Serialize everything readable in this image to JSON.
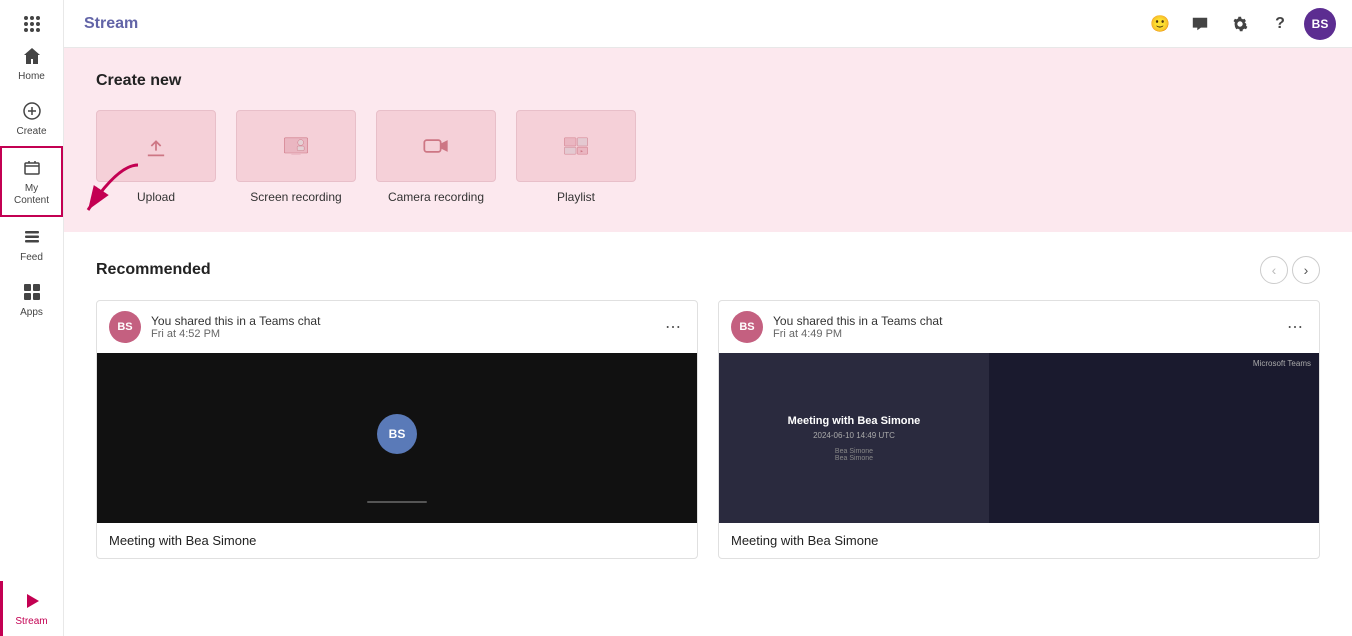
{
  "app": {
    "name": "Stream"
  },
  "topbar": {
    "icons": [
      "emoji",
      "chat",
      "settings",
      "help"
    ],
    "avatar_initials": "BS"
  },
  "sidebar": {
    "items": [
      {
        "id": "home",
        "label": "Home",
        "icon": "home"
      },
      {
        "id": "create",
        "label": "Create",
        "icon": "create"
      },
      {
        "id": "my-content",
        "label": "My Content",
        "icon": "my-content",
        "highlighted": true
      },
      {
        "id": "feed",
        "label": "Feed",
        "icon": "feed"
      },
      {
        "id": "apps",
        "label": "Apps",
        "icon": "apps"
      },
      {
        "id": "stream",
        "label": "Stream",
        "icon": "stream",
        "active": true
      }
    ]
  },
  "create_section": {
    "title": "Create new",
    "cards": [
      {
        "id": "upload",
        "label": "Upload",
        "icon": "upload"
      },
      {
        "id": "screen-recording",
        "label": "Screen recording",
        "icon": "screen"
      },
      {
        "id": "camera-recording",
        "label": "Camera recording",
        "icon": "camera"
      },
      {
        "id": "playlist",
        "label": "Playlist",
        "icon": "playlist"
      }
    ]
  },
  "recommended_section": {
    "title": "Recommended",
    "cards": [
      {
        "id": "card1",
        "shared_text": "You shared this in a Teams chat",
        "time": "Fri at 4:52 PM",
        "title": "Meeting with Bea Simone",
        "user_initials": "BS"
      },
      {
        "id": "card2",
        "shared_text": "You shared this in a Teams chat",
        "time": "Fri at 4:49 PM",
        "title": "Meeting with Bea Simone",
        "user_initials": "BS",
        "meeting_title": "Meeting with Bea Simone",
        "meeting_date": "2024-06-10 14:49 UTC",
        "meeting_names": "Bea Simone / Bea Simone",
        "ms_teams_label": "Microsoft Teams"
      }
    ]
  }
}
